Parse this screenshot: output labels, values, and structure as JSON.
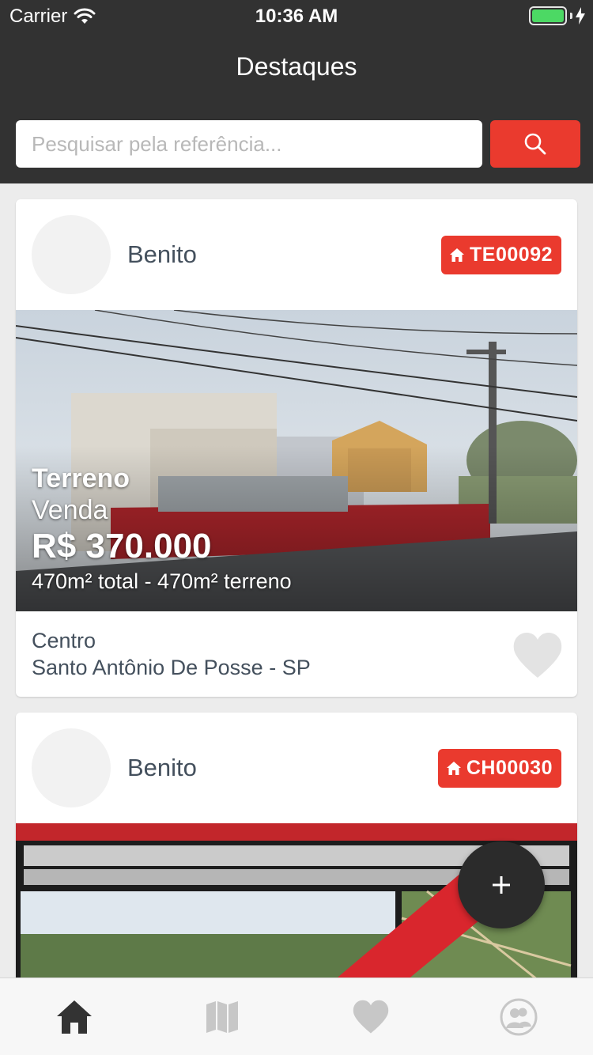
{
  "status_bar": {
    "carrier": "Carrier",
    "time": "10:36 AM"
  },
  "header": {
    "title": "Destaques"
  },
  "search": {
    "placeholder": "Pesquisar pela referência...",
    "value": ""
  },
  "listings": [
    {
      "owner": "Benito",
      "reference": "TE00092",
      "type": "Terreno",
      "deal": "Venda",
      "price": "R$ 370.000",
      "area": "470m² total - 470m² terreno",
      "neighborhood": "Centro",
      "city": "Santo Antônio De Posse - SP",
      "favorited": false
    },
    {
      "owner": "Benito",
      "reference": "CH00030"
    }
  ],
  "fab": {
    "label": "+"
  },
  "tabs": [
    "home",
    "map",
    "favorites",
    "profile"
  ],
  "colors": {
    "accent": "#ea3a2e",
    "header_bg": "#323232",
    "active_tab": "#333333",
    "inactive_tab": "#c7c7c7"
  }
}
